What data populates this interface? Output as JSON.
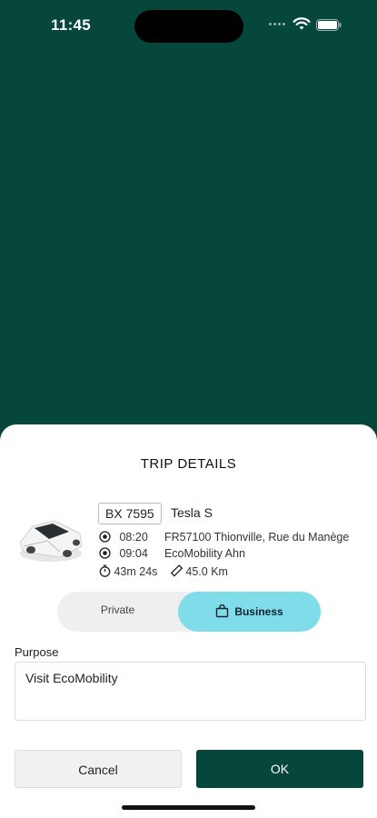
{
  "status_bar": {
    "time": "11:45"
  },
  "sheet": {
    "title": "TRIP DETAILS",
    "vehicle": {
      "plate": "BX 7595",
      "model": "Tesla S",
      "image_icon": "car-icon"
    },
    "trip": {
      "start": {
        "time": "08:20",
        "location": "FR57100 Thionville, Rue du Manège"
      },
      "end": {
        "time": "09:04",
        "location": "EcoMobility Ahn"
      },
      "duration": "43m 24s",
      "distance": "45.0 Km"
    },
    "type_toggle": {
      "options": [
        "Private",
        "Business"
      ],
      "selected": "Business"
    },
    "purpose": {
      "label": "Purpose",
      "value": "Visit EcoMobility"
    },
    "buttons": {
      "cancel": "Cancel",
      "ok": "OK"
    }
  },
  "colors": {
    "primary": "#05473a",
    "accent": "#7fdde9"
  }
}
